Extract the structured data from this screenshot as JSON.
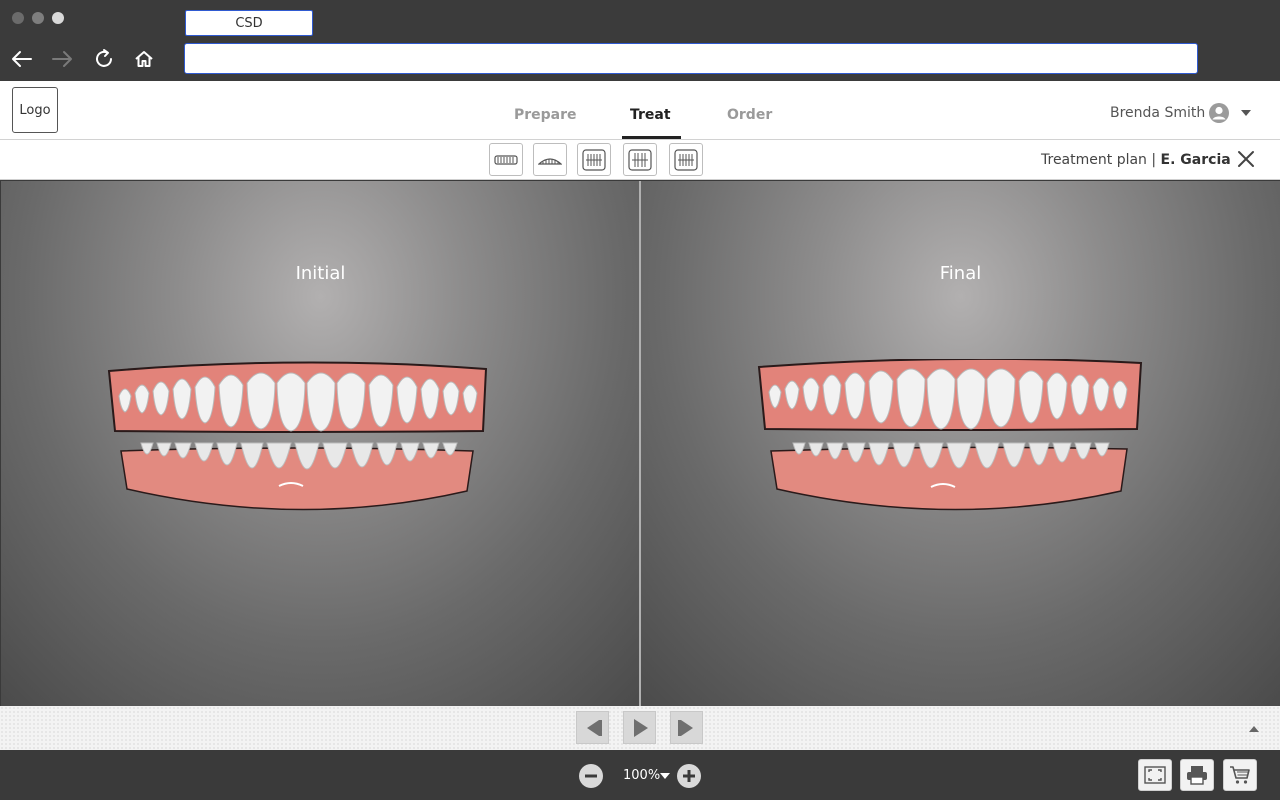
{
  "browser": {
    "tab_title": "CSD",
    "address_value": ""
  },
  "header": {
    "logo_text": "Logo",
    "tabs": [
      {
        "label": "Prepare",
        "active": false
      },
      {
        "label": "Treat",
        "active": true
      },
      {
        "label": "Order",
        "active": false
      }
    ],
    "user_name": "Brenda Smith"
  },
  "toolbar": {
    "view_buttons": [
      "upper-jaw-view-icon",
      "lower-jaw-view-icon",
      "left-side-view-icon",
      "front-view-icon",
      "right-side-view-icon"
    ],
    "plan_prefix": "Treatment plan | ",
    "plan_name": "E. Garcia"
  },
  "viewports": {
    "left_label": "Initial",
    "right_label": "Final"
  },
  "bottom": {
    "zoom_value": "100%"
  },
  "colors": {
    "accent_border": "#2f5ad1",
    "gum": "#e2837a",
    "tooth": "#ececec"
  }
}
